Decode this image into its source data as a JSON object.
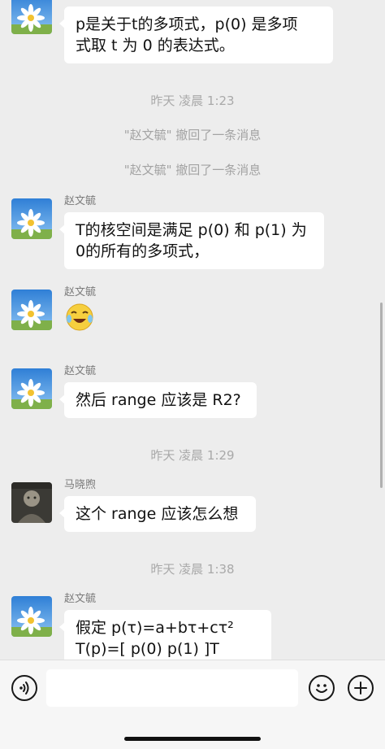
{
  "messages_top": {
    "bubble_lines": [
      "p是关于t的多项式，p(0) 是多项",
      "式取 t 为 0 的表达式。"
    ]
  },
  "timestamps": {
    "t1": "昨天 凌晨 1:23",
    "t2": "昨天 凌晨 1:29",
    "t3": "昨天 凌晨 1:38"
  },
  "recalls": {
    "r1": "\"赵文毓\" 撤回了一条消息",
    "r2": "\"赵文毓\" 撤回了一条消息"
  },
  "msg_kernel": {
    "sender": "赵文毓",
    "lines": [
      "T的核空间是满足 p(0) 和 p(1) 为",
      "0的所有的多项式，"
    ]
  },
  "msg_sticker": {
    "sender": "赵文毓"
  },
  "msg_range": {
    "sender": "赵文毓",
    "text": "然后 range 应该是 R2?"
  },
  "msg_think": {
    "sender": "马晓煦",
    "text": "这个 range 应该怎么想"
  },
  "msg_assume": {
    "sender": "赵文毓",
    "lines": [
      "假定 p(τ)=a+bτ+cτ²",
      "T(p)=[ p(0)  p(1) ]T"
    ]
  },
  "input": {
    "value": "",
    "placeholder": ""
  },
  "icons": {
    "voice": "voice-icon",
    "emoji": "emoji-icon",
    "add": "plus-icon"
  },
  "colors": {
    "background": "#ededed",
    "bubble": "#ffffff",
    "input_bar": "#f6f6f6"
  }
}
